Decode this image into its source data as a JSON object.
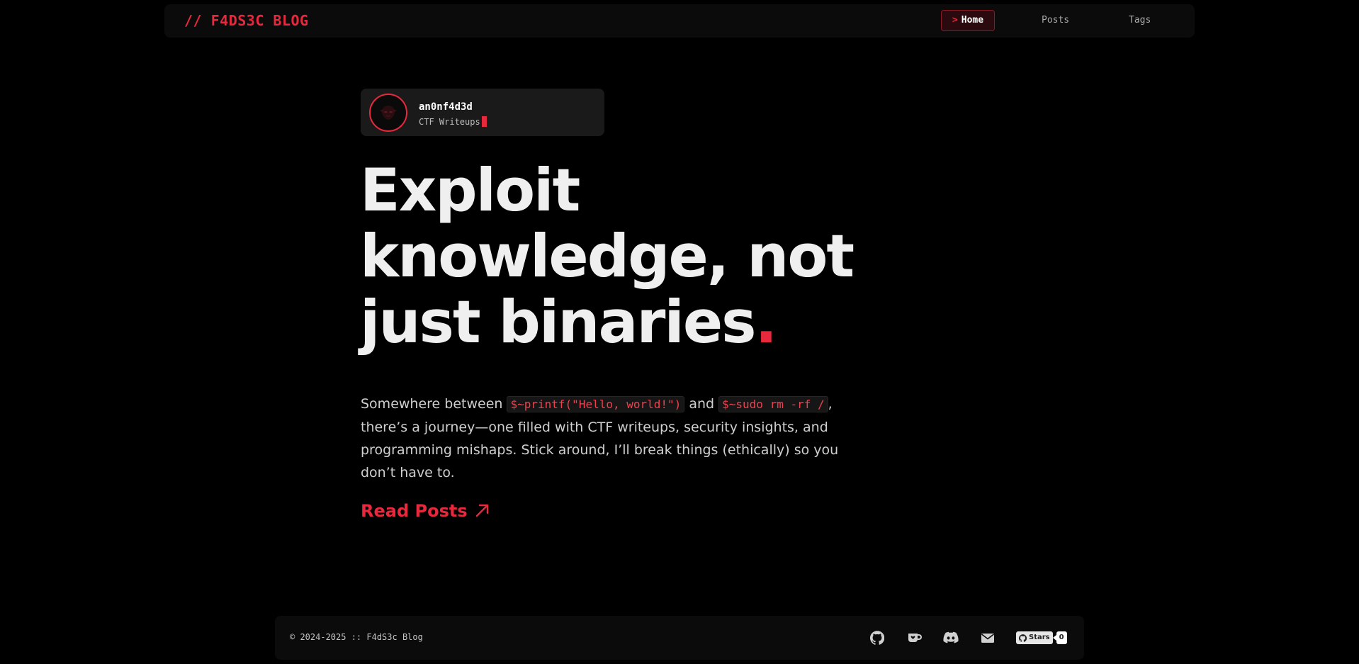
{
  "header": {
    "brand": "// F4DS3C BLOG",
    "nav": {
      "home_prompt": ">",
      "home_label": "Home",
      "posts_label": "Posts",
      "tags_label": "Tags"
    }
  },
  "profile": {
    "name": "an0nf4d3d",
    "subtitle": "CTF Writeups"
  },
  "hero": {
    "line1": "Exploit",
    "line2": "knowledge, not",
    "line3": "just binaries",
    "dot": "."
  },
  "intro": {
    "p1": "Somewhere between ",
    "code1": "$~printf(\"Hello, world!\")",
    "p2": " and ",
    "code2": "$~sudo rm -rf /",
    "p3": ",",
    "line2": "there’s a journey—one filled with CTF writeups, security insights, and",
    "line3": "programming mishaps. Stick around, I’ll break things (ethically) so you",
    "line4": "don’t have to."
  },
  "cta": {
    "label": "Read Posts"
  },
  "footer": {
    "copyright": "© 2024-2025 :: F4dS3c Blog",
    "icons": [
      "github-icon",
      "kofi-icon",
      "discord-icon",
      "mail-icon"
    ],
    "stars_label": "Stars",
    "stars_count": "0"
  },
  "colors": {
    "accent": "#e8283c",
    "background": "#000000",
    "surface": "#0b0b0b",
    "card": "#1a1a1a"
  }
}
